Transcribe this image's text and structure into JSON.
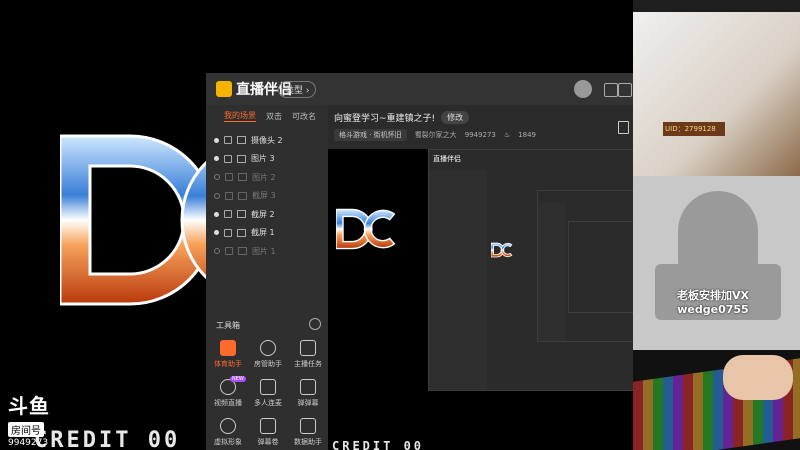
{
  "game": {
    "credit_text": "CREDIT  00",
    "douyu_logo": "斗鱼",
    "room_label": "房间号",
    "room_number": "9949273"
  },
  "app": {
    "brand": "直播伴侣",
    "type_label": "类型",
    "tabs": [
      "我的场景",
      "双击",
      "可改名"
    ],
    "scenes": [
      {
        "label": "摄像头 2",
        "visible": true
      },
      {
        "label": "图片 3",
        "visible": true
      },
      {
        "label": "图片 2",
        "visible": false
      },
      {
        "label": "截屏 3",
        "visible": false
      },
      {
        "label": "截屏 2",
        "visible": true
      },
      {
        "label": "截屏 1",
        "visible": true
      },
      {
        "label": "图片 1",
        "visible": false
      }
    ],
    "toolbox_title": "工具箱",
    "tools": [
      {
        "label": "体育助手",
        "active": true
      },
      {
        "label": "房管助手",
        "active": false
      },
      {
        "label": "主播任务",
        "active": false
      },
      {
        "label": "视频直播",
        "active": false,
        "badge": "NEW"
      },
      {
        "label": "多人连麦",
        "active": false
      },
      {
        "label": "弹弹幕",
        "active": false
      },
      {
        "label": "虚拟形象",
        "active": false
      },
      {
        "label": "弹幕卷",
        "active": false
      },
      {
        "label": "数据助手",
        "active": false
      }
    ],
    "stream_title": "向蜜登学习~重建镇之子!",
    "edit_label": "修改",
    "category": "格斗游戏 · 街机怀旧",
    "streamer": "蜀裂尔家之大",
    "room_id": "9949273",
    "popularity": "1849"
  },
  "right_panel": {
    "uid_label": "UID：2799128",
    "cat_sign_line1": "老板安排加VX",
    "cat_sign_line2": "wedge0755"
  },
  "colors": {
    "accent": "#ff6a2d",
    "brand": "#f5b400"
  }
}
